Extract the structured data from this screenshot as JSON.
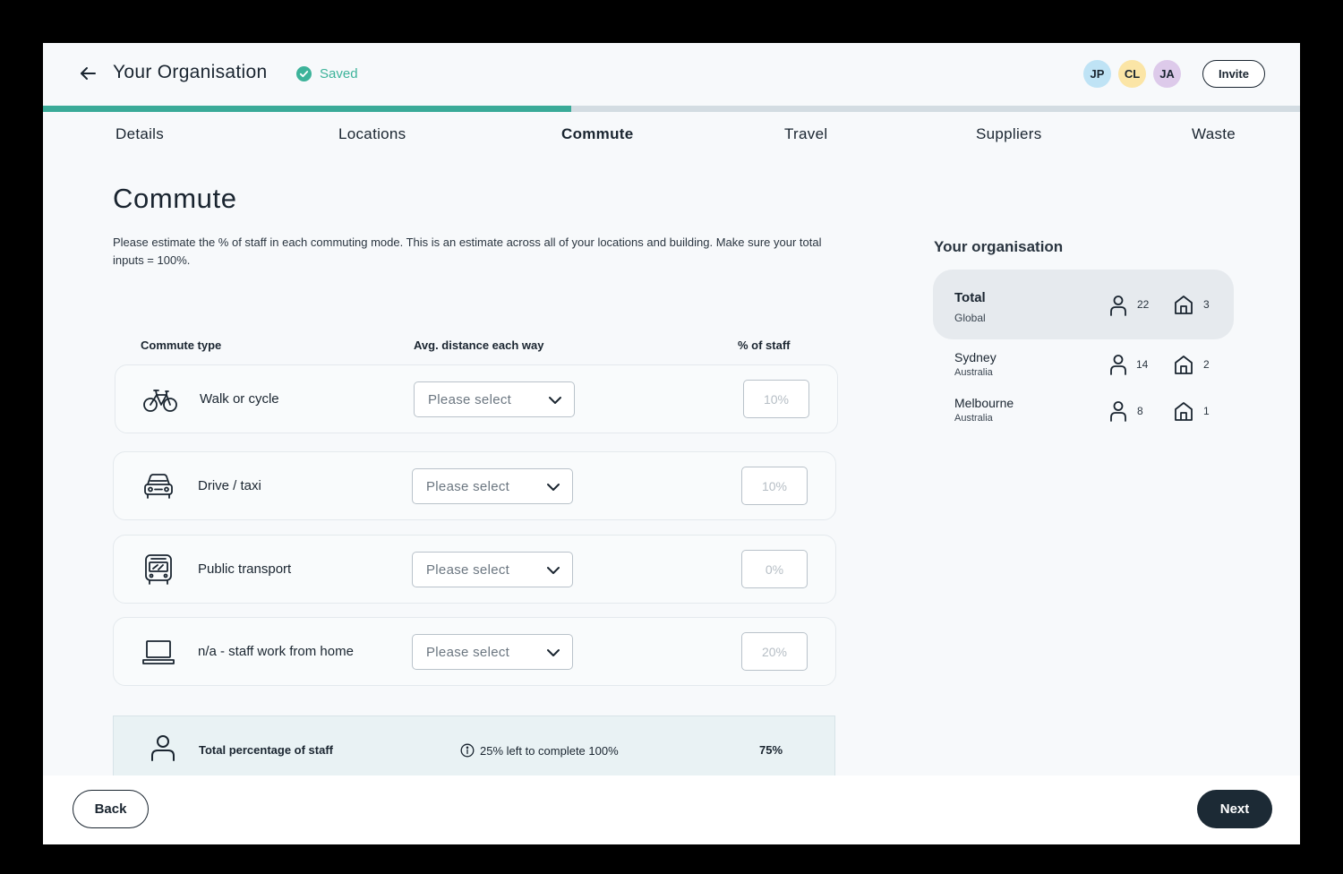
{
  "header": {
    "title": "Your Organisation",
    "saved_label": "Saved",
    "avatars": [
      {
        "initials": "JP",
        "color": "#bfe3f5"
      },
      {
        "initials": "CL",
        "color": "#fbe5a6"
      },
      {
        "initials": "JA",
        "color": "#ddcaea"
      }
    ],
    "invite_label": "Invite"
  },
  "progress": {
    "completed_fraction": 0.42,
    "fill_color": "#3aaa98",
    "track_color": "#d3dce2"
  },
  "tabs": [
    {
      "label": "Details"
    },
    {
      "label": "Locations"
    },
    {
      "label": "Commute",
      "active": true
    },
    {
      "label": "Travel"
    },
    {
      "label": "Suppliers"
    },
    {
      "label": "Waste"
    }
  ],
  "main": {
    "title": "Commute",
    "description": "Please estimate the % of staff in each commuting mode. This is an estimate across all of your locations and building. Make sure your total inputs = 100%.",
    "columns": {
      "type": "Commute type",
      "distance": "Avg. distance each way",
      "staff": "% of staff"
    },
    "rows": [
      {
        "label": "Walk or cycle",
        "icon": "bicycle-icon",
        "select_placeholder": "Please select",
        "percent_placeholder": "10%"
      },
      {
        "label": "Drive / taxi",
        "icon": "car-icon",
        "select_placeholder": "Please select",
        "percent_placeholder": "10%"
      },
      {
        "label": "Public transport",
        "icon": "bus-icon",
        "select_placeholder": "Please select",
        "percent_placeholder": "0%"
      },
      {
        "label": "n/a - staff work from home",
        "icon": "laptop-icon",
        "select_placeholder": "Please select",
        "percent_placeholder": "20%"
      }
    ],
    "total": {
      "label": "Total percentage of staff",
      "info": "25% left to complete 100%",
      "value": "75%"
    }
  },
  "sidebar": {
    "title": "Your organisation",
    "total": {
      "name": "Total",
      "sub": "Global",
      "staff": "22",
      "buildings": "3"
    },
    "locations": [
      {
        "name": "Sydney",
        "sub": "Australia",
        "staff": "14",
        "buildings": "2"
      },
      {
        "name": "Melbourne",
        "sub": "Australia",
        "staff": "8",
        "buildings": "1"
      }
    ]
  },
  "footer": {
    "back_label": "Back",
    "next_label": "Next"
  }
}
